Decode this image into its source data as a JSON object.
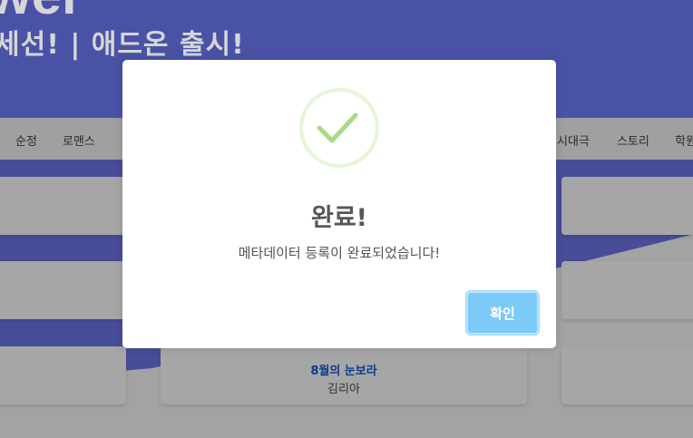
{
  "hero": {
    "title": "wer",
    "subtitle": "세선! | 애드온 출시!"
  },
  "genres": [
    "순정",
    "로맨스",
    "시대극",
    "스토리",
    "학원"
  ],
  "cards": [
    {
      "title": "8월의 눈보라",
      "author": "김리아"
    }
  ],
  "modal": {
    "title": "완료!",
    "message": "메타데이터 등록이 완료되었습니다!",
    "confirm_label": "확인",
    "icon": "check-icon",
    "icon_color": "#a5dc86",
    "ring_color": "#e6f5d8",
    "button_color": "#7ccaf8"
  }
}
